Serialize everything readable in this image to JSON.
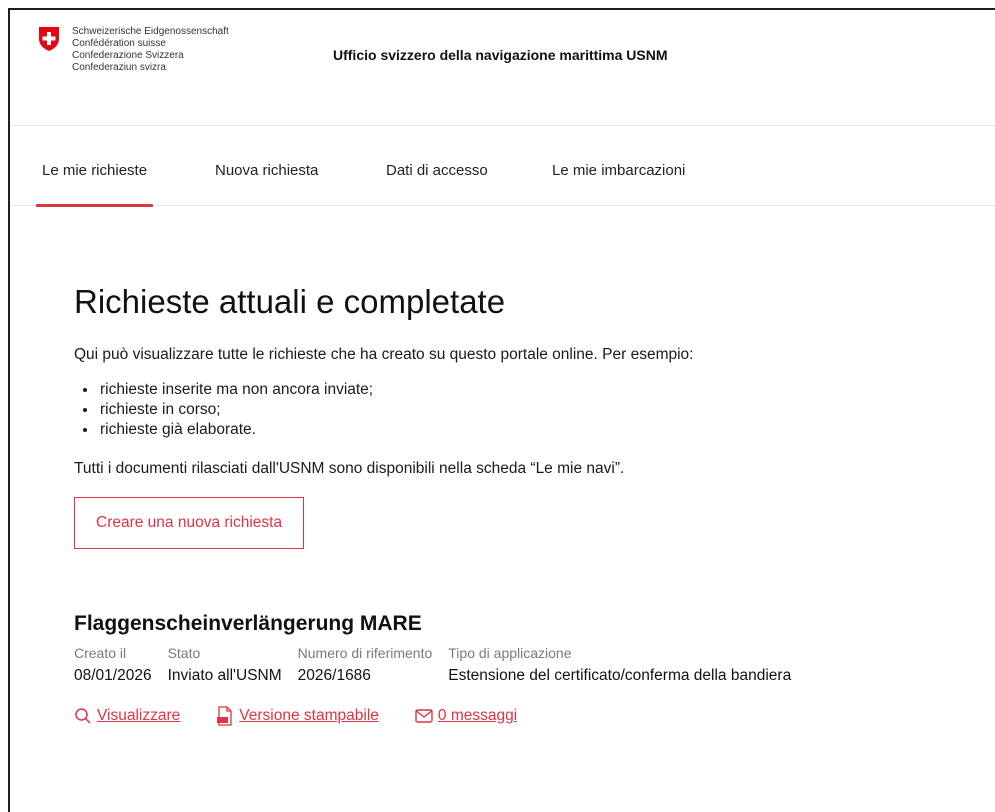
{
  "header": {
    "confederation_lines": [
      "Schweizerische Eidgenossenschaft",
      "Confédération suisse",
      "Confederazione Svizzera",
      "Confederaziun svizra"
    ],
    "office_name": "Ufficio svizzero della navigazione marittima USNM"
  },
  "nav": {
    "items": [
      {
        "label": "Le mie richieste",
        "active": true
      },
      {
        "label": "Nuova richiesta"
      },
      {
        "label": "Dati di accesso"
      },
      {
        "label": "Le mie imbarcazioni"
      }
    ]
  },
  "main": {
    "title": "Richieste attuali e completate",
    "intro": "Qui può visualizzare tutte le richieste che ha creato su questo portale online. Per esempio:",
    "bullets": [
      "richieste inserite ma non ancora inviate;",
      "richieste in corso;",
      "richieste già elaborate."
    ],
    "note": "Tutti i documenti rilasciati dall'USNM sono disponibili nella scheda “Le mie navi”.",
    "create_button": "Creare una nuova richiesta"
  },
  "request": {
    "title": "Flaggenscheinverlängerung MARE",
    "columns": [
      {
        "label": "Creato il",
        "value": "08/01/2026"
      },
      {
        "label": "Stato",
        "value": "Inviato all'USNM"
      },
      {
        "label": "Numero di riferimento",
        "value": "2026/1686"
      },
      {
        "label": "Tipo di applicazione",
        "value": "Estensione del certificato/conferma della bandiera"
      }
    ],
    "actions": {
      "view": "Visualizzare",
      "print": "Versione stampabile",
      "messages": "0 messaggi"
    }
  },
  "colors": {
    "accent": "#dc3545",
    "swiss_red": "#e30613"
  }
}
